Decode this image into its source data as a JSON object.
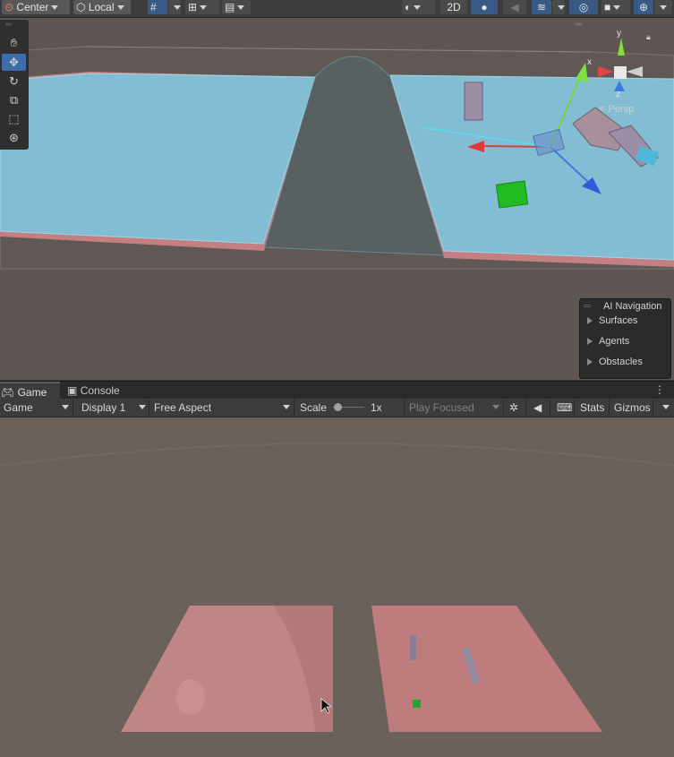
{
  "toolbar": {
    "pivot_label": "Center",
    "space_label": "Local",
    "mode_2d_label": "2D"
  },
  "scene": {
    "tools": [
      "hand",
      "move",
      "rotate",
      "scale",
      "rect",
      "transform"
    ],
    "gizmo": {
      "x_label": "x",
      "y_label": "y",
      "z_label": "z",
      "persp_label": "Persp"
    },
    "ai_navigation": {
      "title": "AI Navigation",
      "items": [
        "Surfaces",
        "Agents",
        "Obstacles"
      ]
    }
  },
  "tabs": [
    {
      "label": "Game",
      "icon": "gamepad-icon",
      "active": true
    },
    {
      "label": "Console",
      "icon": "console-icon",
      "active": false
    }
  ],
  "game_toolbar": {
    "mode": "Game",
    "display": "Display 1",
    "aspect": "Free Aspect",
    "scale_label": "Scale",
    "scale_value": "1x",
    "play_mode": "Play Focused",
    "stats_label": "Stats",
    "gizmos_label": "Gizmos"
  },
  "colors": {
    "accent_blue": "#3e6ea8",
    "navmesh_blue": "#7db9d2",
    "ground_pink": "#c98686",
    "scene_bg": "#5d5653",
    "game_bg": "#6a615b"
  }
}
